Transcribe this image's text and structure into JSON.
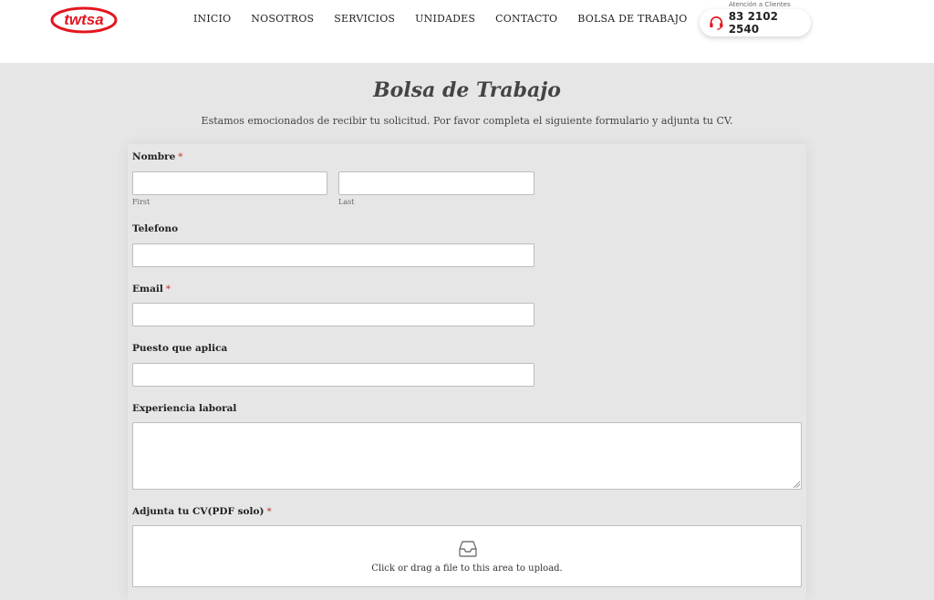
{
  "header": {
    "logo_text": "twtsa",
    "nav": [
      "INICIO",
      "NOSOTROS",
      "SERVICIOS",
      "UNIDADES",
      "CONTACTO",
      "BOLSA DE TRABAJO"
    ],
    "atencion_label": "Atención a Clientes",
    "phone": "83 2102 2540",
    "brand_color": "#e3161f"
  },
  "page": {
    "title": "Bolsa de Trabajo",
    "intro": "Estamos emocionados de recibir tu solicitud. Por favor completa el siguiente formulario y adjunta tu CV."
  },
  "form": {
    "nombre_label": "Nombre",
    "required_mark": "*",
    "first_sublabel": "First",
    "last_sublabel": "Last",
    "first_value": "",
    "last_value": "",
    "telefono_label": "Telefono",
    "telefono_value": "",
    "email_label": "Email",
    "email_value": "",
    "puesto_label": "Puesto que aplica",
    "puesto_value": "",
    "experiencia_label": "Experiencia laboral",
    "experiencia_value": "",
    "cv_label": "Adjunta tu CV(PDF solo)",
    "upload_text": "Click or drag a file to this area to upload.",
    "upload_icon": "inbox-tray-icon"
  }
}
